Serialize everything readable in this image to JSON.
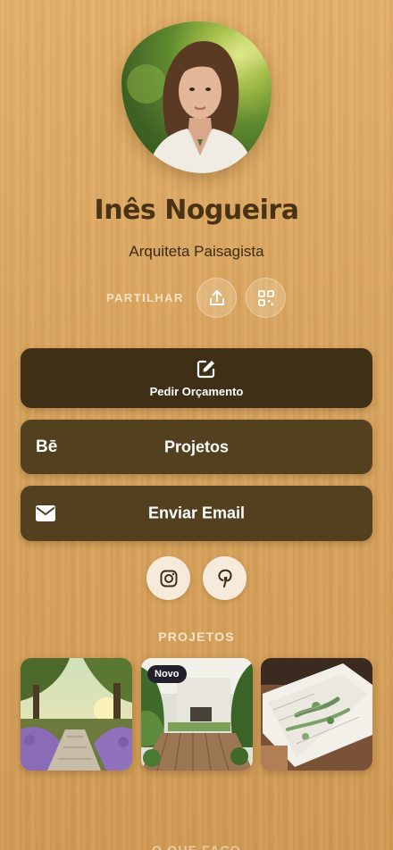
{
  "profile": {
    "name": "Inês Nogueira",
    "role": "Arquiteta Paisagista",
    "avatar_icon": "profile-photo"
  },
  "share": {
    "label": "PARTILHAR",
    "share_icon": "share-upload-icon",
    "qr_icon": "qr-code-icon"
  },
  "links": [
    {
      "label": "Pedir Orçamento",
      "icon": "edit-icon",
      "color": "#3f2f17"
    },
    {
      "label": "Projetos",
      "icon": "behance-icon",
      "icon_text": "Bē",
      "color": "#52401f"
    },
    {
      "label": "Enviar Email",
      "icon": "mail-icon",
      "color": "#52401f"
    }
  ],
  "social": [
    {
      "icon": "instagram-icon"
    },
    {
      "icon": "pinterest-icon"
    }
  ],
  "projects": {
    "title": "PROJETOS",
    "items": [
      {
        "image": "lavender-garden-path"
      },
      {
        "image": "deck-garden",
        "badge": "Novo"
      },
      {
        "image": "garden-plan-sketch"
      }
    ]
  },
  "footer": {
    "label": "O QUE FAÇO"
  },
  "colors": {
    "background": "#d9a35c",
    "name_text": "#4a3214",
    "primary_button": "#3f2f17",
    "secondary_button": "#52401f",
    "social_button": "#f6eadb"
  }
}
